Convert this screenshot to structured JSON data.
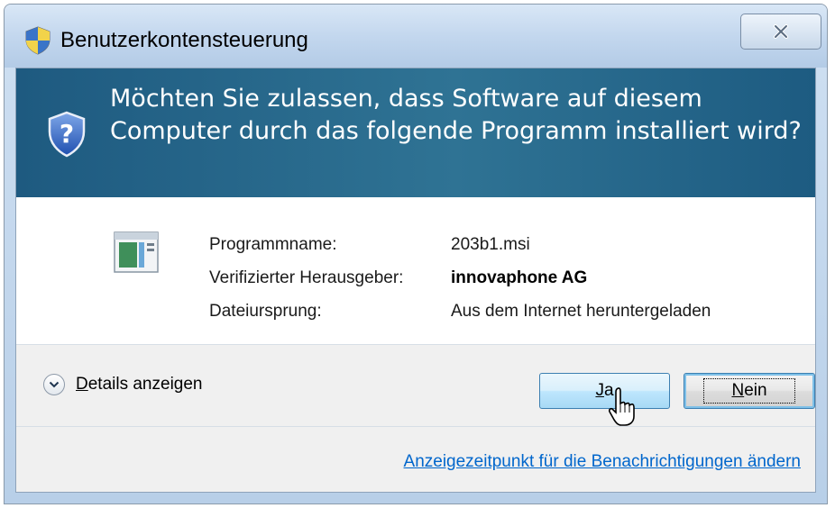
{
  "window": {
    "title": "Benutzerkontensteuerung",
    "close_icon": "close-icon"
  },
  "banner": {
    "headline": "Möchten Sie zulassen, dass Software auf diesem Computer durch das folgende Programm installiert wird?",
    "icon": "shield-question-icon",
    "background_color": "#246488"
  },
  "program_info": {
    "icon": "installer-program-icon",
    "rows": [
      {
        "label": "Programmname:",
        "value": "203b1.msi",
        "bold": false
      },
      {
        "label": "Verifizierter Herausgeber:",
        "value": "innovaphone AG",
        "bold": true
      },
      {
        "label": "Dateiursprung:",
        "value": "Aus dem Internet heruntergeladen",
        "bold": false
      }
    ]
  },
  "details": {
    "toggle_icon": "chevron-down-icon",
    "label_accesskey": "D",
    "label_rest": "etails anzeigen"
  },
  "buttons": {
    "yes_accesskey": "J",
    "yes_rest": "a",
    "no_accesskey": "N",
    "no_rest": "ein"
  },
  "footer": {
    "link": "Anzeigezeitpunkt für die Benachrichtigungen ändern",
    "link_color": "#0066cc"
  },
  "cursor": {
    "icon": "hand-pointer-icon"
  }
}
